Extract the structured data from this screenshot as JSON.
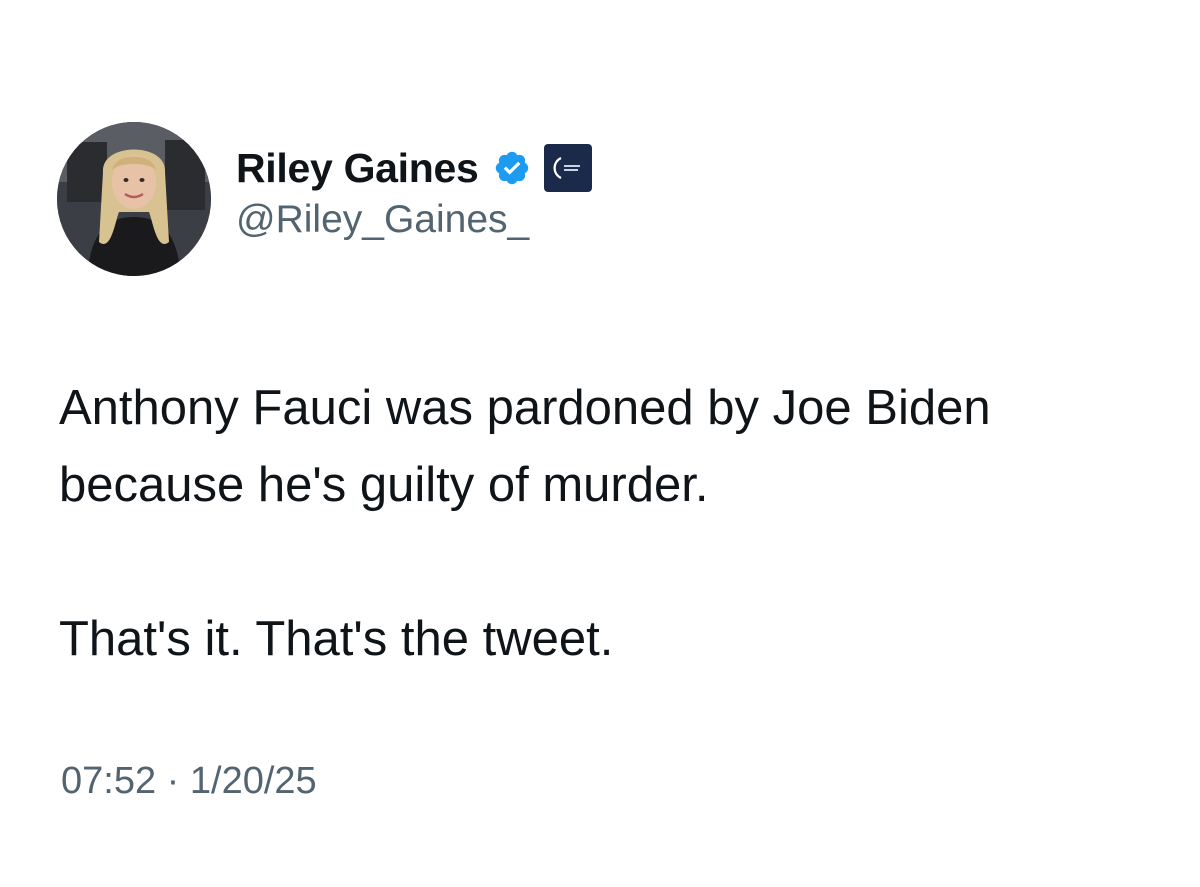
{
  "author": {
    "display_name": "Riley Gaines",
    "handle": "@Riley_Gaines_",
    "verified": true,
    "verified_color": "#1d9bf0",
    "affiliate_badge_color": "#1b2a4a",
    "avatar_icon": "profile-photo"
  },
  "tweet": {
    "lines": [
      "Anthony Fauci was pardoned by Joe Biden",
      "because he's guilty of murder.",
      "That's it. That's the tweet."
    ],
    "time": "07:52",
    "separator": "·",
    "date": "1/20/25"
  },
  "colors": {
    "text_primary": "#0f1419",
    "text_secondary": "#536471",
    "background": "#ffffff"
  }
}
